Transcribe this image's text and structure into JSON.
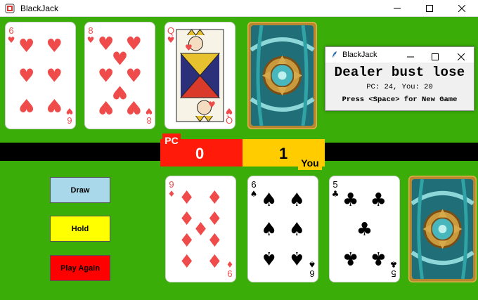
{
  "window": {
    "title": "BlackJack"
  },
  "dialog": {
    "title": "BlackJack",
    "headline": "Dealer bust lose",
    "score_line": "PC: 24, You: 20",
    "hint": "Press <Space> for New Game"
  },
  "score": {
    "pc_label": "PC",
    "pc_value": "0",
    "you_label": "You",
    "you_value": "1"
  },
  "buttons": {
    "draw": "Draw",
    "hold": "Hold",
    "play_again": "Play Again"
  },
  "dealer_cards": [
    {
      "rank": "6",
      "suit": "hearts"
    },
    {
      "rank": "8",
      "suit": "hearts"
    },
    {
      "rank": "Q",
      "suit": "hearts"
    }
  ],
  "player_cards": [
    {
      "rank": "9",
      "suit": "diamonds"
    },
    {
      "rank": "6",
      "suit": "spades"
    },
    {
      "rank": "5",
      "suit": "clubs"
    }
  ],
  "colors": {
    "felt": "#3aad08",
    "pc": "#ff1a0a",
    "you": "#ffcc00",
    "draw_btn": "#a9d8ea",
    "hold_btn": "#ffff00",
    "play_again_btn": "#ff0000",
    "red_suit": "#ef4b4b",
    "black_suit": "#000000"
  }
}
